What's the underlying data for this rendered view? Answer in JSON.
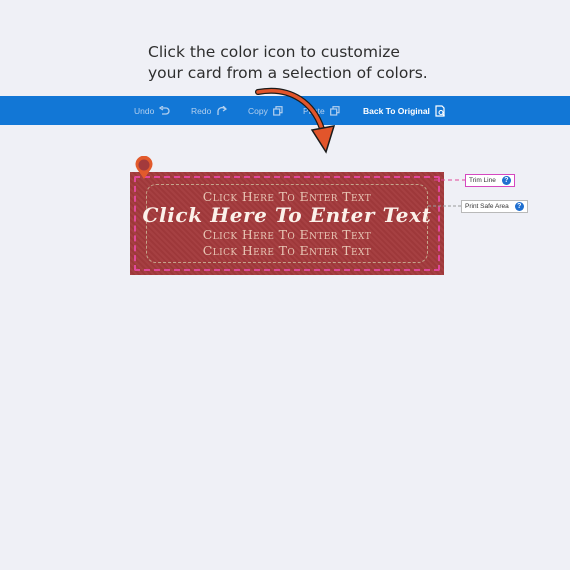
{
  "instruction": {
    "line1": "Click the color icon to customize",
    "line2": "your card from a selection of colors."
  },
  "toolbar": {
    "undo_label": "Undo",
    "redo_label": "Redo",
    "copy_label": "Copy",
    "paste_label": "Paste",
    "back_label": "Back To Original",
    "bg_color": "#1277d6"
  },
  "card": {
    "bg_color": "#a33a3c",
    "line1": "Click Here To Enter Text",
    "script_line": "Click Here To Enter Text",
    "line3": "Click Here To Enter Text",
    "line4": "Click Here To Enter Text"
  },
  "callouts": {
    "trim_line": "Trim Line",
    "print_safe_area": "Print Safe Area",
    "help_symbol": "?"
  },
  "icons": {
    "undo": "undo-icon",
    "redo": "redo-icon",
    "copy": "copy-icon",
    "paste": "paste-icon",
    "back": "reset-icon",
    "color_pin": "color-pin-icon",
    "pointer_arrow": "curved-arrow-icon"
  }
}
